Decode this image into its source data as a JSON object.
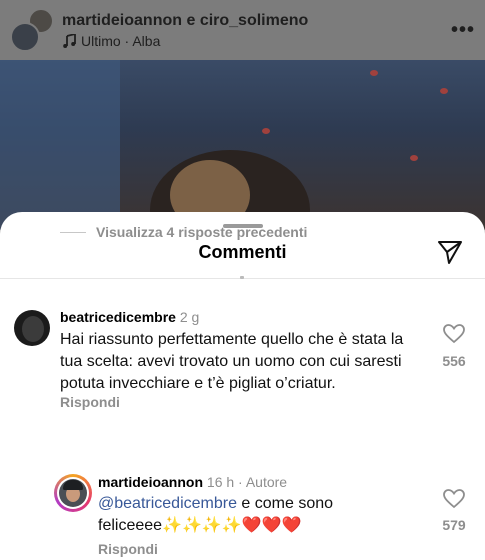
{
  "post": {
    "user1": "martideioannon",
    "conjunction": " e ",
    "user2": "ciro_solimeno",
    "music_icon": "music-note-icon",
    "song": "Ultimo",
    "separator": " · ",
    "location": "Alba",
    "more_icon": "more-horizontal-icon"
  },
  "sheet": {
    "title": "Commenti",
    "share_icon": "paper-plane-icon"
  },
  "comments": [
    {
      "user": "beatricedicembre",
      "time": "2 g",
      "text_lines": [
        "Hai riassunto perfettamente quello che è stata la",
        "tua scelta: avevi trovato un uomo con cui  saresti",
        "potuta invecchiare e t’è pigliat o’criatur."
      ],
      "reply_label": "Rispondi",
      "likes": "556"
    }
  ],
  "view_replies": "Visualizza 4 risposte precedenti",
  "reply": {
    "user": "martideioannon",
    "time": "16 h",
    "separator": " · ",
    "badge": "Autore",
    "mention": "@beatricedicembre",
    "text_after_mention": " e come sono",
    "text_line2": "feliceeee✨✨✨✨❤️❤️❤️",
    "reply_label": "Rispondi",
    "likes": "579"
  },
  "colors": {
    "mention": "#385898",
    "muted": "#8e8e8e"
  }
}
